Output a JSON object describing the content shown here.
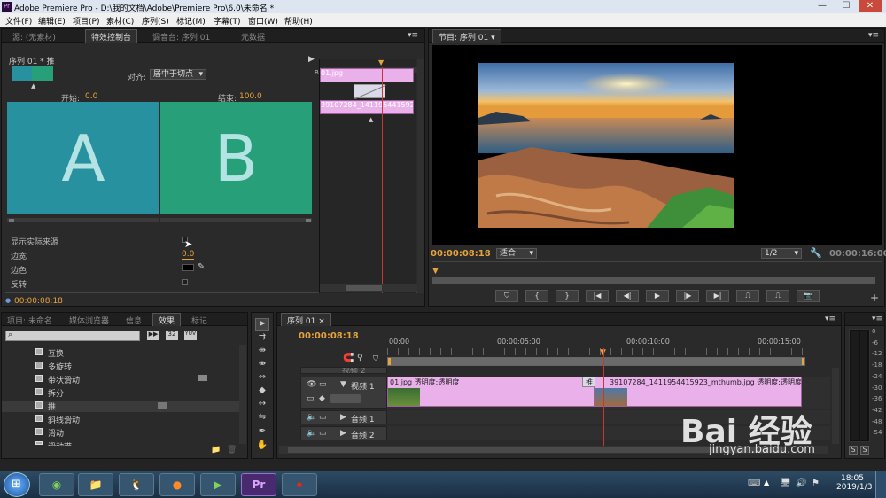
{
  "window": {
    "title": "Adobe Premiere Pro - D:\\我的文档\\Adobe\\Premiere Pro\\6.0\\未命名 *",
    "logo": "Pr"
  },
  "menu": [
    "文件(F)",
    "编辑(E)",
    "项目(P)",
    "素材(C)",
    "序列(S)",
    "标记(M)",
    "字幕(T)",
    "窗口(W)",
    "帮助(H)"
  ],
  "left_tabs": [
    "源: (无素材)",
    "特效控制台",
    "调音台: 序列 01",
    "元数据"
  ],
  "effect_controls": {
    "header": "序列 01 * 推",
    "align_label": "对齐:",
    "align_value": "居中于切点",
    "start_label": "开始:",
    "start_value": "0.0",
    "end_label": "结束:",
    "end_value": "100.0",
    "preview_a": "A",
    "preview_b": "B",
    "show_source": "显示实际来源",
    "border_width": "边宽",
    "border_width_value": "0.0",
    "border_color": "边色",
    "reverse": "反转",
    "timecode": "00:00:08:18",
    "clip1": "01.jpg",
    "clip2": "39107284_1411954415923_m",
    "mini_label": "B"
  },
  "program": {
    "tab": "节目: 序列 01",
    "timecode": "00:00:08:18",
    "fit": "适合",
    "resolution": "1/2",
    "duration": "00:00:16:00",
    "controls": [
      "marker",
      "in",
      "out",
      "go-in",
      "step-back",
      "play",
      "step-forward",
      "go-out",
      "lift",
      "extract",
      "export-frame"
    ]
  },
  "project_tabs": [
    "项目: 未命名",
    "媒体浏览器",
    "信息",
    "效果",
    "标记"
  ],
  "effects": [
    "互换",
    "多旋转",
    "带状滑动",
    "拆分",
    "推",
    "斜线滑动",
    "滑动",
    "滑动带"
  ],
  "effects_selected": "推",
  "timeline": {
    "tab": "序列 01",
    "timecode": "00:00:08:18",
    "ruler": [
      "00:00",
      "00:00:05:00",
      "00:00:10:00",
      "00:00:15:00"
    ],
    "tracks": [
      {
        "name": "视频 2"
      },
      {
        "name": "视频 1"
      },
      {
        "name": "音频 1"
      },
      {
        "name": "音频 2"
      }
    ],
    "clip1_label": "01.jpg  透明度:透明度",
    "transition_label": "推",
    "clip2_label": "39107284_1411954415923_mthumb.jpg  透明度:透明度",
    "meter_labels": [
      "0",
      "-6",
      "-12",
      "-18",
      "-24",
      "-30",
      "-36",
      "-42",
      "-48",
      "-54"
    ],
    "meter_buttons": [
      "S",
      "S"
    ]
  },
  "taskbar": {
    "time": "18:05",
    "date": "2019/1/3",
    "pr_label": "Pr"
  },
  "watermark": {
    "text": "Bai 经验",
    "sub": "jingyan.baidu.com"
  }
}
